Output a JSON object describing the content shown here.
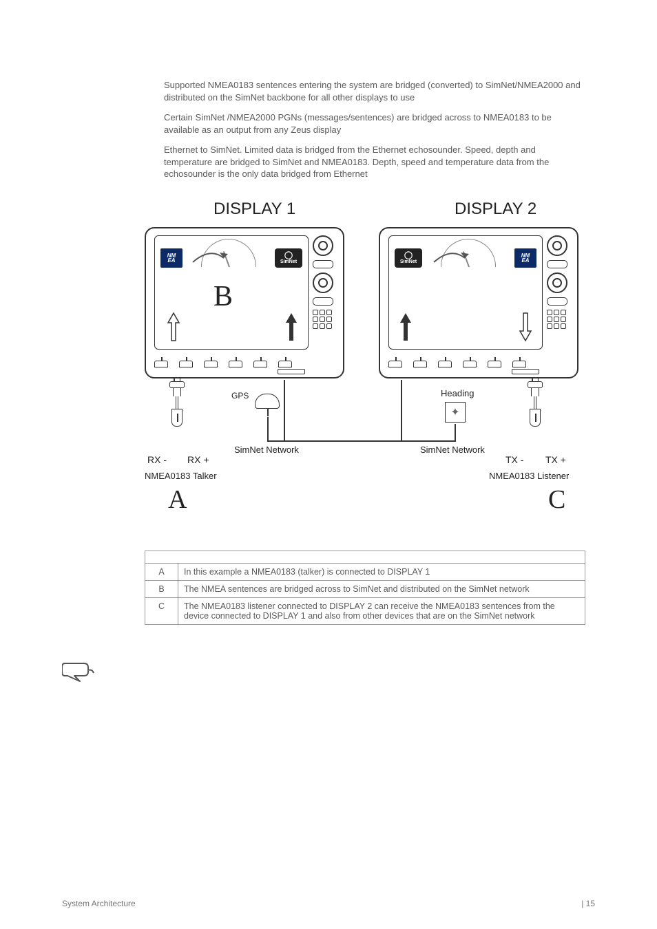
{
  "paragraphs": {
    "p1": "Supported NMEA0183 sentences entering the system are bridged (converted) to SimNet/NMEA2000 and distributed on the SimNet backbone for all other displays to use",
    "p2": "Certain SimNet /NMEA2000 PGNs (messages/sentences) are bridged across to NMEA0183 to be available as an output from any Zeus display",
    "p3": "Ethernet to SimNet. Limited data is bridged from the Ethernet echosounder. Speed, depth and temperature are bridged to SimNet and NMEA0183. Depth, speed and temperature data from the echosounder is the only data bridged from Ethernet"
  },
  "diagram": {
    "display1": "DISPLAY 1",
    "display2": "DISPLAY 2",
    "letter_b": "B",
    "gps": "GPS",
    "simnet_network": "SimNet Network",
    "heading": "Heading",
    "rx_minus": "RX -",
    "rx_plus": "RX +",
    "tx_minus": "TX -",
    "tx_plus": "TX +",
    "nmea_talker": "NMEA0183 Talker",
    "nmea_listener": "NMEA0183 Listener",
    "letter_a": "A",
    "letter_c": "C",
    "nmea_logo_top": "NM",
    "nmea_logo_bot": "EA",
    "simnet_logo": "SimNet"
  },
  "table": {
    "rows": [
      {
        "key": "A",
        "text": "In this example a NMEA0183 (talker) is connected to DISPLAY 1"
      },
      {
        "key": "B",
        "text": "The NMEA sentences are bridged across to SimNet and distributed on the SimNet network"
      },
      {
        "key": "C",
        "text": "The NMEA0183 listener connected to DISPLAY 2 can receive the NMEA0183 sentences from the device connected to DISPLAY 1 and also from other devices that are on the SimNet network"
      }
    ]
  },
  "footer": {
    "left": "System Architecture",
    "right": "| 15"
  }
}
